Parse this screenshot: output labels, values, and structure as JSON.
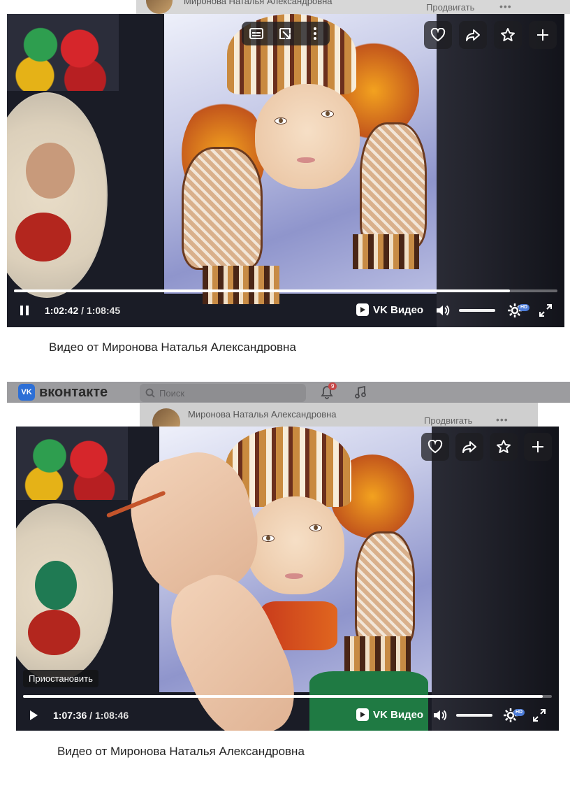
{
  "shot1": {
    "strip": {
      "name": "Миронова Наталья Александровна",
      "promote": "Продвигать",
      "more": "•••"
    },
    "player": {
      "current_time": "1:02:42",
      "separator": " / ",
      "total_time": "1:08:45",
      "progress": 0.912,
      "brand": "VK Видео",
      "hd": "HD",
      "volume": 0.9
    },
    "caption": "Видео от Миронова Наталья Александровна"
  },
  "shot2": {
    "header": {
      "logo": "вконтакте",
      "logo_badge": "VK",
      "search_placeholder": "Поиск",
      "notifications_count": "9"
    },
    "strip": {
      "name": "Миронова Наталья Александровна",
      "promote": "Продвигать",
      "more": "•••"
    },
    "player": {
      "current_time": "1:07:36",
      "separator": " / ",
      "total_time": "1:08:46",
      "progress": 0.983,
      "brand": "VK Видео",
      "hd": "HD",
      "tooltip": "Приостановить",
      "volume": 0.9
    },
    "caption": "Видео от Миронова Наталья Александровна"
  },
  "icons": {
    "like": "heart-icon",
    "share": "share-arrow-icon",
    "favorite": "star-icon",
    "add": "plus-icon",
    "subtitles": "subtitles-icon",
    "pip": "picture-in-picture-icon",
    "more": "more-vertical-icon",
    "pause": "pause-icon",
    "play": "play-icon",
    "volume": "volume-icon",
    "settings": "gear-icon",
    "fullscreen": "fullscreen-icon",
    "search": "search-icon",
    "bell": "bell-icon",
    "music": "music-note-icon"
  },
  "colors": {
    "progress": "#ffffff",
    "hd_badge": "#4b7bd8",
    "vk_blue": "#2d6fd6",
    "notification": "#e64646"
  }
}
